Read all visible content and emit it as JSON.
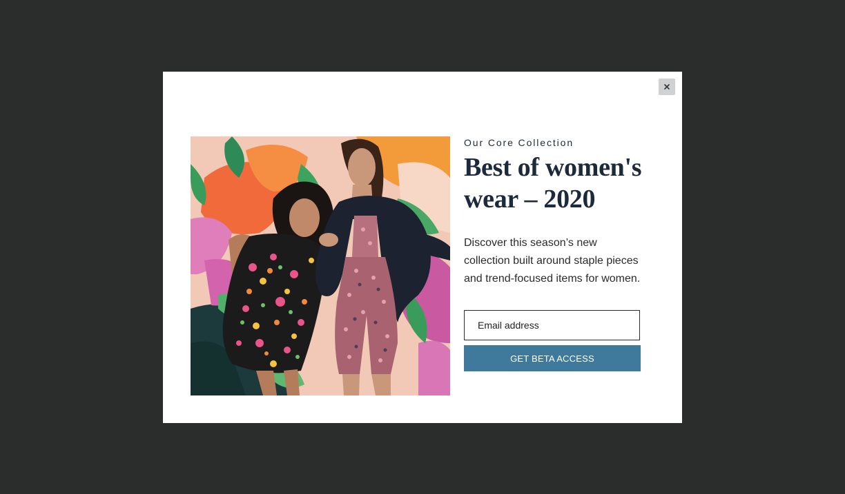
{
  "page": {
    "backdrop_color": "#2b2c2c"
  },
  "modal": {
    "close_icon": "close-icon",
    "close_glyph": "×",
    "image": {
      "description": "two-women-fashion-photo",
      "icon": "hero-photo"
    },
    "eyebrow": "Our Core Collection",
    "title": "Best of women's wear – 2020",
    "description": "Discover this season’s new collection built around staple pieces and trend-focused items for women.",
    "email": {
      "placeholder": "Email address",
      "value": ""
    },
    "cta_label": "GET BETA ACCESS",
    "colors": {
      "accent": "#3f7a9c",
      "title": "#1d2a3b",
      "close_bg": "#cfd1d3"
    }
  }
}
